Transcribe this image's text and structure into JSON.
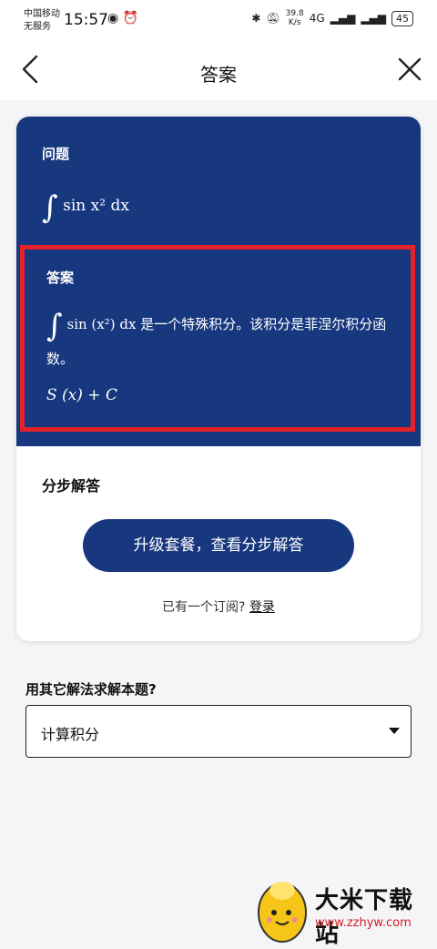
{
  "status_bar": {
    "carrier_line1": "中国移动",
    "carrier_line2": "无服务",
    "time": "15:57",
    "net_speed": "39.8",
    "net_unit": "K/s",
    "network": "4G",
    "battery": "45"
  },
  "nav": {
    "title": "答案",
    "back_icon": "chevron-left-icon",
    "close_icon": "close-icon"
  },
  "question": {
    "label": "问题",
    "expression": "sin x² dx"
  },
  "answer": {
    "label": "答案",
    "expression": "sin (x²) dx",
    "text": "是一个特殊积分。该积分是菲涅尔积分函数。",
    "result": "S (x) + C",
    "highlight_color": "#e5212b"
  },
  "steps": {
    "label": "分步解答",
    "upgrade_button": "升级套餐，查看分步解答",
    "subscribed_prefix": "已有一个订阅?",
    "login_link": "登录"
  },
  "other_methods": {
    "label": "用其它解法求解本题?",
    "selected": "计算积分"
  },
  "watermark": {
    "brand": "大米下载站",
    "url_www": "www.",
    "url_domain": "zzhyw",
    "url_tld": ".com"
  },
  "colors": {
    "primary": "#17377f",
    "background": "#f5f5f7"
  }
}
